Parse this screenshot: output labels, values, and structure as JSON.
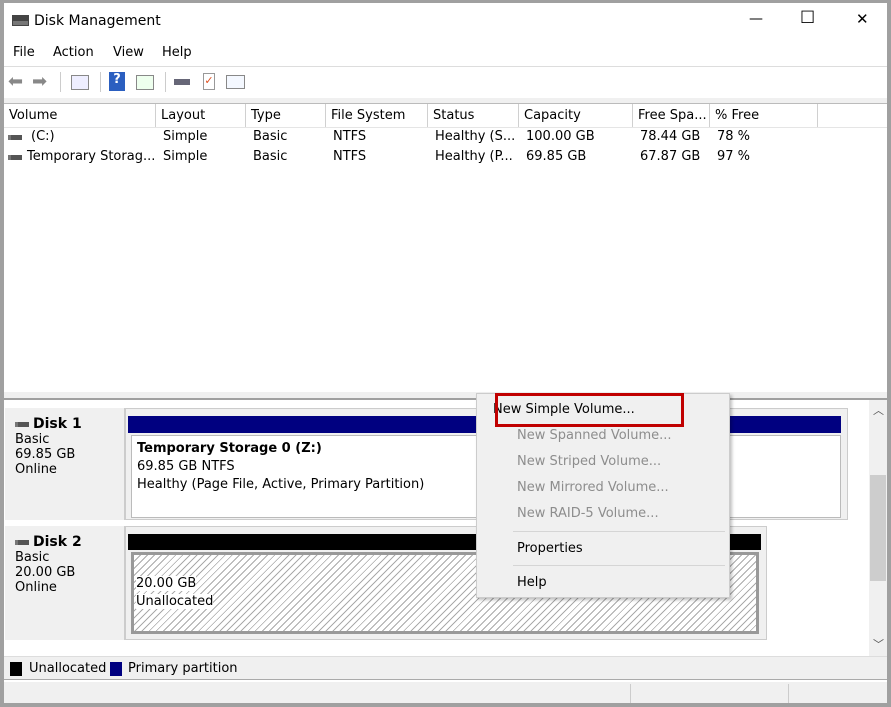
{
  "window": {
    "title": "Disk Management",
    "icon": "disk-management-icon",
    "controls": {
      "minimize": "—",
      "maximize": "☐",
      "close": "✕"
    }
  },
  "menu": [
    "File",
    "Action",
    "View",
    "Help"
  ],
  "toolbar": [
    "back-icon",
    "forward-icon",
    "console-tree-icon",
    "help-icon",
    "action-pane-icon",
    "connect-icon",
    "checklist-icon",
    "properties-icon"
  ],
  "volume_list": {
    "columns": [
      "Volume",
      "Layout",
      "Type",
      "File System",
      "Status",
      "Capacity",
      "Free Spa...",
      "% Free"
    ],
    "rows": [
      [
        "(C:)",
        "Simple",
        "Basic",
        "NTFS",
        "Healthy (S...",
        "100.00 GB",
        "78.44 GB",
        "78 %"
      ],
      [
        "Temporary Storag...",
        "Simple",
        "Basic",
        "NTFS",
        "Healthy (P...",
        "69.85 GB",
        "67.87 GB",
        "97 %"
      ]
    ]
  },
  "disks": [
    {
      "name": "Disk 1",
      "type": "Basic",
      "size": "69.85 GB",
      "status": "Online",
      "partition": {
        "title": "Temporary Storage 0  (Z:)",
        "size": "69.85 GB NTFS",
        "status": "Healthy (Page File, Active, Primary Partition)"
      }
    },
    {
      "name": "Disk 2",
      "type": "Basic",
      "size": "20.00 GB",
      "status": "Online",
      "partition": {
        "size": "20.00 GB",
        "status": "Unallocated"
      }
    }
  ],
  "legend": [
    {
      "label": "Unallocated",
      "color": "#000000"
    },
    {
      "label": "Primary partition",
      "color": "#000080"
    }
  ],
  "context_menu": {
    "items": [
      {
        "label": "New Simple Volume...",
        "enabled": true,
        "highlighted": true
      },
      {
        "label": "New Spanned Volume...",
        "enabled": false
      },
      {
        "label": "New Striped Volume...",
        "enabled": false
      },
      {
        "label": "New Mirrored Volume...",
        "enabled": false
      },
      {
        "label": "New RAID-5 Volume...",
        "enabled": false
      },
      {
        "label": "Properties",
        "enabled": true
      },
      {
        "label": "Help",
        "enabled": true
      }
    ]
  },
  "colors": {
    "primary": "#000080",
    "unallocated": "#000000",
    "highlight_box": "#c00000"
  }
}
